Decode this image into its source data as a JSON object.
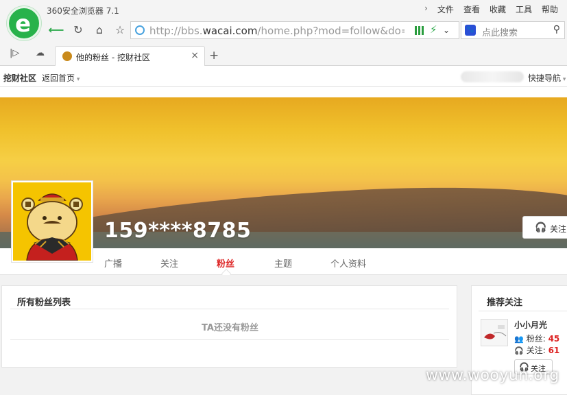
{
  "browser": {
    "title": "360安全浏览器 7.1",
    "menu": [
      "文件",
      "查看",
      "收藏",
      "工具",
      "帮助"
    ],
    "url_prefix": "http://bbs.",
    "url_host": "wacai.com",
    "url_path": "/home.php?mod=follow&do=f",
    "search_placeholder": "点此搜索",
    "tab_title": "他的粉丝 - 挖财社区"
  },
  "site": {
    "name": "挖财社区",
    "home_link": "返回首页",
    "quick_nav": "快捷导航"
  },
  "profile": {
    "username": "159****8785",
    "follow_label": "关注",
    "tabs": [
      "广播",
      "关注",
      "粉丝",
      "主题",
      "个人资料"
    ],
    "active_tab": "粉丝"
  },
  "fans_panel": {
    "title": "所有粉丝列表",
    "empty_text": "TA还没有粉丝"
  },
  "recommend": {
    "title": "推荐关注",
    "user_name": "小小月光",
    "fans_label": "粉丝:",
    "fans_count": "45",
    "follow_label": "关注:",
    "follow_count": "61",
    "button_label": "关注"
  },
  "watermark": "www.wooyun.org"
}
